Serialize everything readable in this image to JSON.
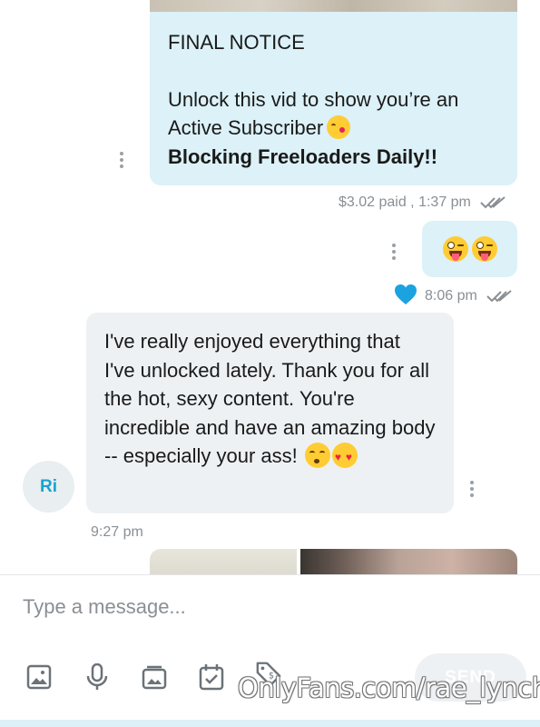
{
  "messages": {
    "outgoing_notice": {
      "line1": "FINAL NOTICE",
      "line2": "Unlock this vid to show you’re an Active Subscriber",
      "line3": "Blocking Freeloaders Daily!!",
      "meta": "$3.02 paid , 1:37 pm"
    },
    "outgoing_emoji": {
      "emoji": "😜😜",
      "meta": "8:06 pm",
      "liked": true
    },
    "incoming": {
      "avatar_initials": "Ri",
      "text": "I've really enjoyed everything that I've unlocked lately. Thank you for all the hot, sexy content. You're incredible and have an amazing body -- especially your ass!",
      "meta": "9:27 pm"
    }
  },
  "composer": {
    "placeholder": "Type a message...",
    "send_label": "SEND",
    "tools": [
      "image-icon",
      "microphone-icon",
      "media-vault-icon",
      "schedule-icon",
      "price-tag-icon"
    ]
  },
  "watermark": "OnlyFans.com/rae_lynch",
  "colors": {
    "outgoing_bubble": "#dcf1f8",
    "incoming_bubble": "#eef1f4",
    "accent": "#00aff0"
  }
}
